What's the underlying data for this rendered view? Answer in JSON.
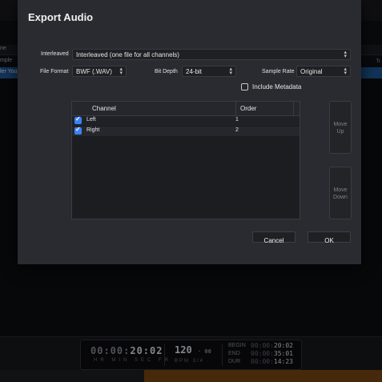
{
  "background": {
    "left_column_header": "ne",
    "left_rows": [
      "mple",
      "ler You"
    ],
    "right_column_header": "Tr",
    "transport": {
      "timecode_prefix": "00:00:",
      "timecode_highlight": "20:02",
      "timecode_labels": "HR MIN SEC FR",
      "tempo": "120",
      "tempo_fraction": "· 00",
      "tempo_labels": "BPM  3/4 ·",
      "begin_label": "BEGIN",
      "end_label": "END",
      "dur_label": "DUR",
      "begin_prefix": "00:00:",
      "begin_value": "20:02",
      "end_prefix": "00:00:",
      "end_value": "35:01",
      "dur_prefix": "00:00:",
      "dur_value": "14:23"
    }
  },
  "dialog": {
    "title": "Export Audio",
    "interleaved_label": "Interleaved",
    "interleaved_value": "Interleaved (one file for all channels)",
    "file_format_label": "File Format",
    "file_format_value": "BWF (.WAV)",
    "bit_depth_label": "Bit Depth",
    "bit_depth_value": "24-bit",
    "sample_rate_label": "Sample Rate",
    "sample_rate_value": "Original",
    "include_metadata_label": "Include Metadata",
    "include_metadata_checked": false,
    "table": {
      "headers": {
        "channel": "Channel",
        "order": "Order"
      },
      "rows": [
        {
          "checked": true,
          "channel": "Left",
          "order": "1"
        },
        {
          "checked": true,
          "channel": "Right",
          "order": "2"
        }
      ]
    },
    "move_up_line1": "Move",
    "move_up_line2": "Up",
    "move_down_line1": "Move",
    "move_down_line2": "Down",
    "cancel_label": "Cancel",
    "ok_label": "OK",
    "accent_color": "#3b82f6"
  }
}
